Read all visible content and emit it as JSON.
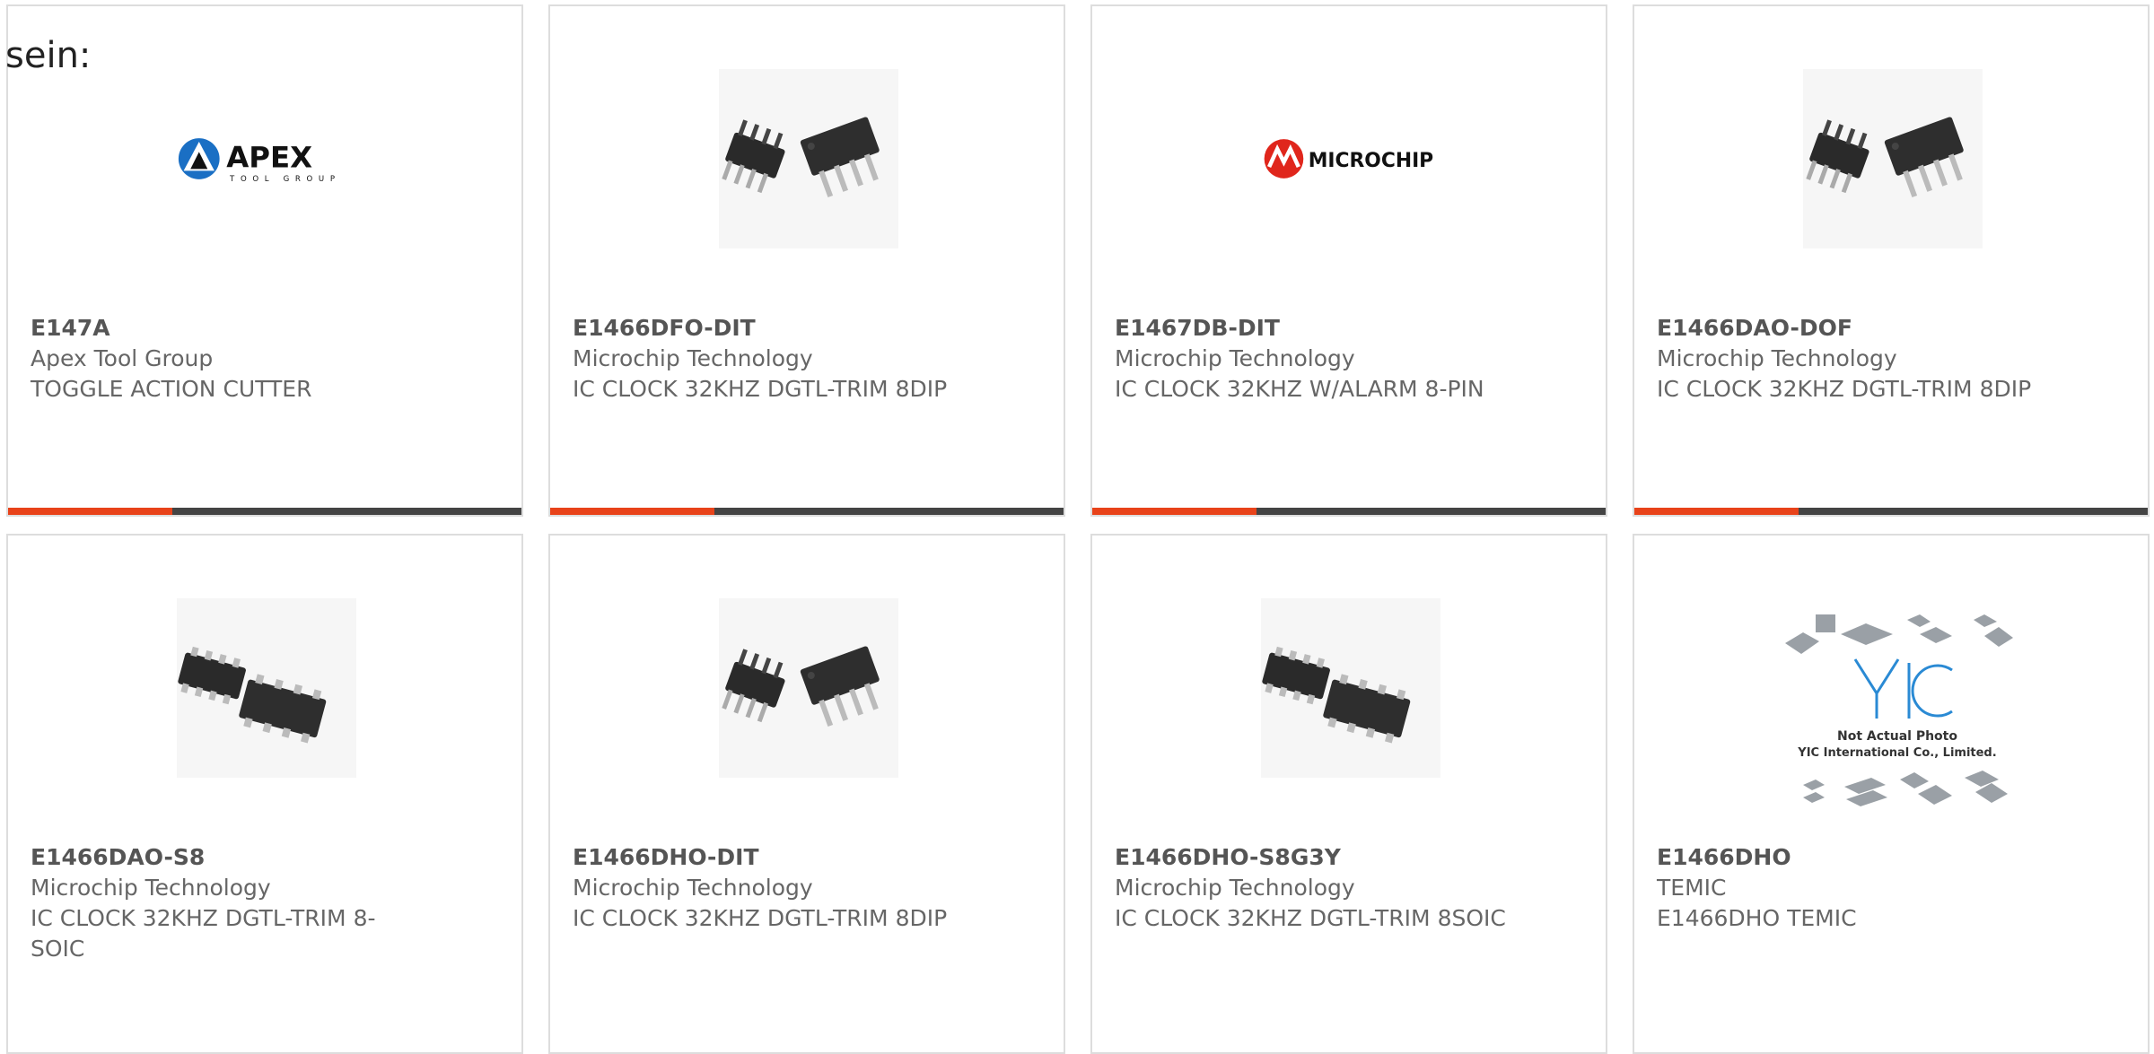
{
  "intro": {
    "text": "sein:"
  },
  "accent_color": "#e8431a",
  "bar_color": "#444444",
  "products": [
    {
      "part_number": "E147A",
      "manufacturer": "Apex Tool Group",
      "description": "TOGGLE ACTION CUTTER",
      "image": "apex-tool-group-logo",
      "logo_text": "APEX",
      "logo_subtext": "TOOL GROUP"
    },
    {
      "part_number": "E1466DFO-DIT",
      "manufacturer": "Microchip Technology",
      "description": "IC CLOCK 32KHZ DGTL-TRIM 8DIP",
      "image": "dip-chip-photo"
    },
    {
      "part_number": "E1467DB-DIT",
      "manufacturer": "Microchip Technology",
      "description": "IC CLOCK 32KHZ W/ALARM 8-PIN",
      "image": "microchip-logo",
      "logo_text": "MICROCHIP"
    },
    {
      "part_number": "E1466DAO-DOF",
      "manufacturer": "Microchip Technology",
      "description": "IC CLOCK 32KHZ DGTL-TRIM 8DIP",
      "image": "dip-chip-photo"
    },
    {
      "part_number": "E1466DAO-S8",
      "manufacturer": "Microchip Technology",
      "description": "IC CLOCK 32KHZ DGTL-TRIM 8-SOIC",
      "image": "soic-chip-photo"
    },
    {
      "part_number": "E1466DHO-DIT",
      "manufacturer": "Microchip Technology",
      "description": "IC CLOCK 32KHZ DGTL-TRIM 8DIP",
      "image": "dip-chip-photo"
    },
    {
      "part_number": "E1466DHO-S8G3Y",
      "manufacturer": "Microchip Technology",
      "description": "IC CLOCK 32KHZ DGTL-TRIM 8SOIC",
      "image": "soic-chip-photo"
    },
    {
      "part_number": "E1466DHO",
      "manufacturer": "TEMIC",
      "description": "E1466DHO TEMIC",
      "image": "yic-placeholder-photo",
      "image_caption_1": "Not Actual Photo",
      "image_caption_2": "YIC International Co., Limited.",
      "logo_text": "YIC"
    }
  ]
}
